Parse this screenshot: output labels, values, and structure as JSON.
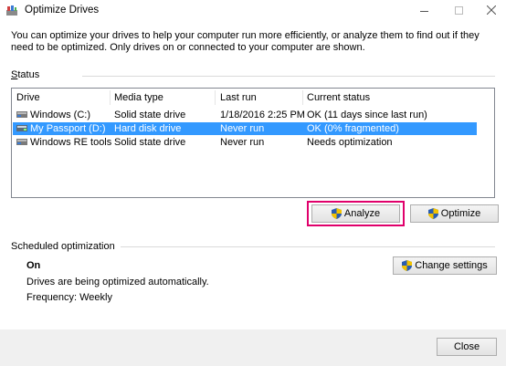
{
  "window": {
    "title": "Optimize Drives",
    "icon": "optimize-drives-icon",
    "controls": [
      "minimize",
      "maximize",
      "close"
    ]
  },
  "description": "You can optimize your drives to help your computer run more efficiently, or analyze them to find out if they need to be optimized. Only drives on or connected to your computer are shown.",
  "status": {
    "label": "Status",
    "columns": [
      "Drive",
      "Media type",
      "Last run",
      "Current status"
    ],
    "rows": [
      {
        "drive": "Windows (C:)",
        "media": "Solid state drive",
        "last_run": "1/18/2016 2:25 PM",
        "status": "OK (11 days since last run)",
        "selected": false
      },
      {
        "drive": "My Passport (D:)",
        "media": "Hard disk drive",
        "last_run": "Never run",
        "status": "OK (0% fragmented)",
        "selected": true
      },
      {
        "drive": "Windows RE tools",
        "media": "Solid state drive",
        "last_run": "Never run",
        "status": "Needs optimization",
        "selected": false
      }
    ]
  },
  "buttons": {
    "analyze": "Analyze",
    "optimize": "Optimize",
    "change_settings": "Change settings",
    "close": "Close"
  },
  "scheduled": {
    "label": "Scheduled optimization",
    "state": "On",
    "detail": "Drives are being optimized automatically.",
    "frequency": "Frequency: Weekly"
  },
  "colors": {
    "selection": "#3399ff",
    "highlight_frame": "#e0006b",
    "shield_blue": "#2a5db0",
    "shield_yellow": "#f2c200"
  }
}
